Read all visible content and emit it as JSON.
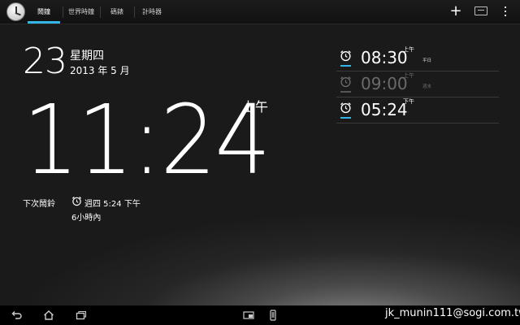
{
  "tabs": [
    {
      "label": "鬧鐘",
      "active": true
    },
    {
      "label": "世界時鐘",
      "active": false
    },
    {
      "label": "碼錶",
      "active": false
    },
    {
      "label": "計時器",
      "active": false
    }
  ],
  "action_icons": [
    "clock-app-icon",
    "add-icon",
    "dock-mode-icon",
    "overflow-menu-icon"
  ],
  "date": {
    "day": "23",
    "weekday": "星期四",
    "year_month": "2013 年 5 月"
  },
  "clock": {
    "time": "11:24",
    "ampm": "上午"
  },
  "next_alarm": {
    "label": "下次鬧鈴",
    "when": "週四 5:24 下午",
    "remaining": "6小時內"
  },
  "alarms": [
    {
      "time": "08:30",
      "ampm": "上午",
      "repeat": "平日",
      "enabled": true
    },
    {
      "time": "09:00",
      "ampm": "上午",
      "repeat": "週末",
      "enabled": false
    },
    {
      "time": "05:24",
      "ampm": "下午",
      "repeat": "",
      "enabled": true
    }
  ],
  "navbar": [
    "back-icon",
    "home-icon",
    "recent-apps-icon",
    "screenshot-icon",
    "phone-icon"
  ],
  "watermark": "jk_munin111@sogi.com.tw",
  "colors": {
    "accent": "#33b5e5",
    "disabled": "#6a6a6a"
  }
}
